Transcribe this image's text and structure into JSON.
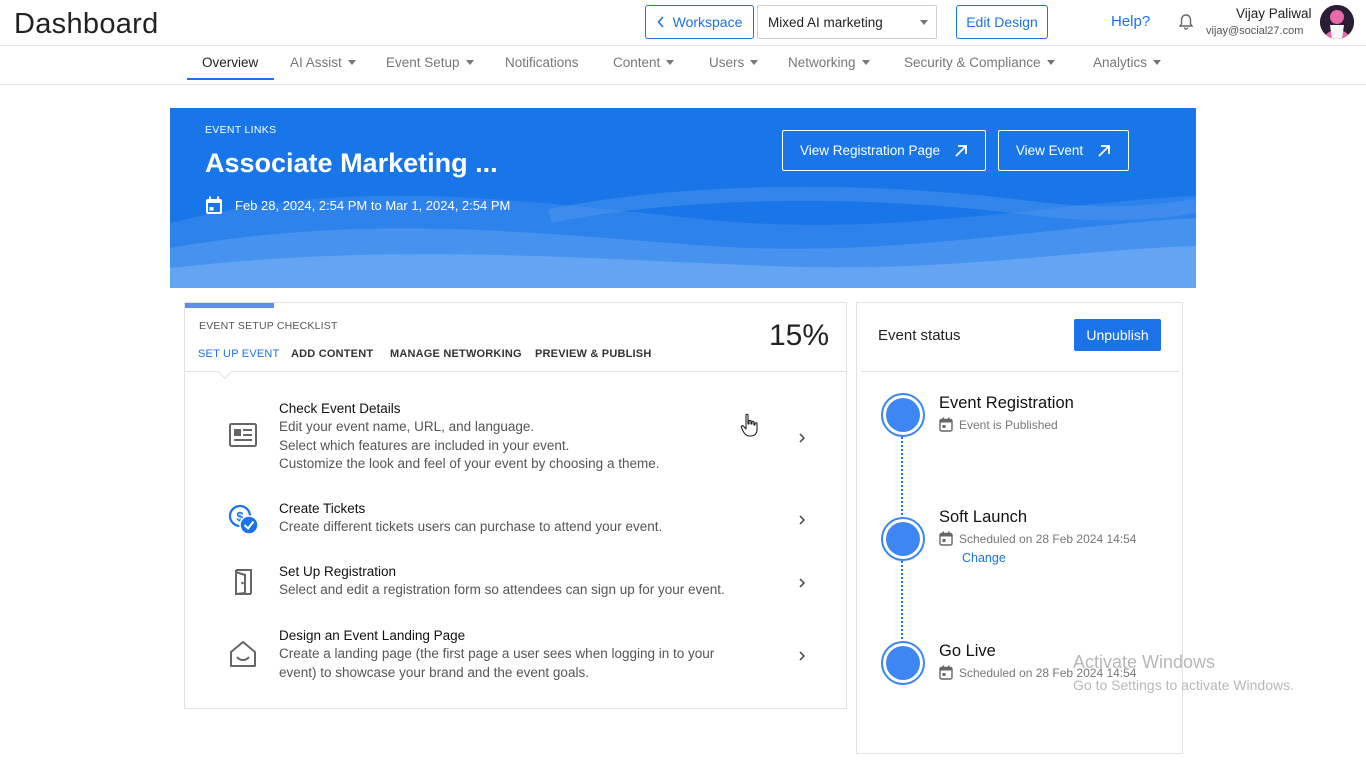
{
  "header": {
    "title": "Dashboard",
    "workspace_button": "Workspace",
    "workspace_select": "Mixed AI marketing",
    "edit_design": "Edit Design",
    "help": "Help?",
    "user_name": "Vijay Paliwal",
    "user_email": "vijay@social27.com"
  },
  "nav": {
    "items": [
      {
        "label": "Overview"
      },
      {
        "label": "AI Assist"
      },
      {
        "label": "Event Setup"
      },
      {
        "label": "Notifications"
      },
      {
        "label": "Content"
      },
      {
        "label": "Users"
      },
      {
        "label": "Networking"
      },
      {
        "label": "Security & Compliance"
      },
      {
        "label": "Analytics"
      }
    ]
  },
  "banner": {
    "label": "EVENT LINKS",
    "title": "Associate Marketing ...",
    "date_range": "Feb 28, 2024, 2:54 PM to Mar 1, 2024, 2:54 PM",
    "view_registration": "View Registration Page",
    "view_event": "View Event",
    "color": "#1976e8"
  },
  "checklist": {
    "label": "EVENT SETUP CHECKLIST",
    "percent": "15%",
    "progress": 0.15,
    "tabs": [
      {
        "label": "SET UP EVENT"
      },
      {
        "label": "ADD CONTENT"
      },
      {
        "label": "MANAGE NETWORKING"
      },
      {
        "label": "PREVIEW & PUBLISH"
      }
    ],
    "tasks": [
      {
        "icon": "newspaper-icon",
        "title": "Check Event Details",
        "desc": [
          "Edit your event name, URL, and language.",
          "Select which features are included in your event.",
          "Customize the look and feel of your event by choosing a theme."
        ]
      },
      {
        "icon": "ticket-check-icon",
        "title": "Create Tickets",
        "desc": [
          "Create different tickets users can purchase to attend your event."
        ]
      },
      {
        "icon": "door-icon",
        "title": "Set Up Registration",
        "desc": [
          "Select and edit a registration form so attendees can sign up for your event."
        ]
      },
      {
        "icon": "house-icon",
        "title": "Design an Event Landing Page",
        "desc": [
          "Create a landing page (the first page a user sees when logging in to your",
          "event) to showcase your brand and the event goals."
        ]
      }
    ]
  },
  "status": {
    "title": "Event status",
    "unpublish": "Unpublish",
    "steps": [
      {
        "title": "Event Registration",
        "sub": "Event is Published"
      },
      {
        "title": "Soft Launch",
        "sub": "Scheduled on 28 Feb 2024 14:54",
        "action": "Change"
      },
      {
        "title": "Go Live",
        "sub": "Scheduled on 28 Feb 2024 14:54"
      }
    ],
    "accent": "#1a73e8"
  },
  "watermark": {
    "line1": "Activate Windows",
    "line2": "Go to Settings to activate Windows."
  }
}
